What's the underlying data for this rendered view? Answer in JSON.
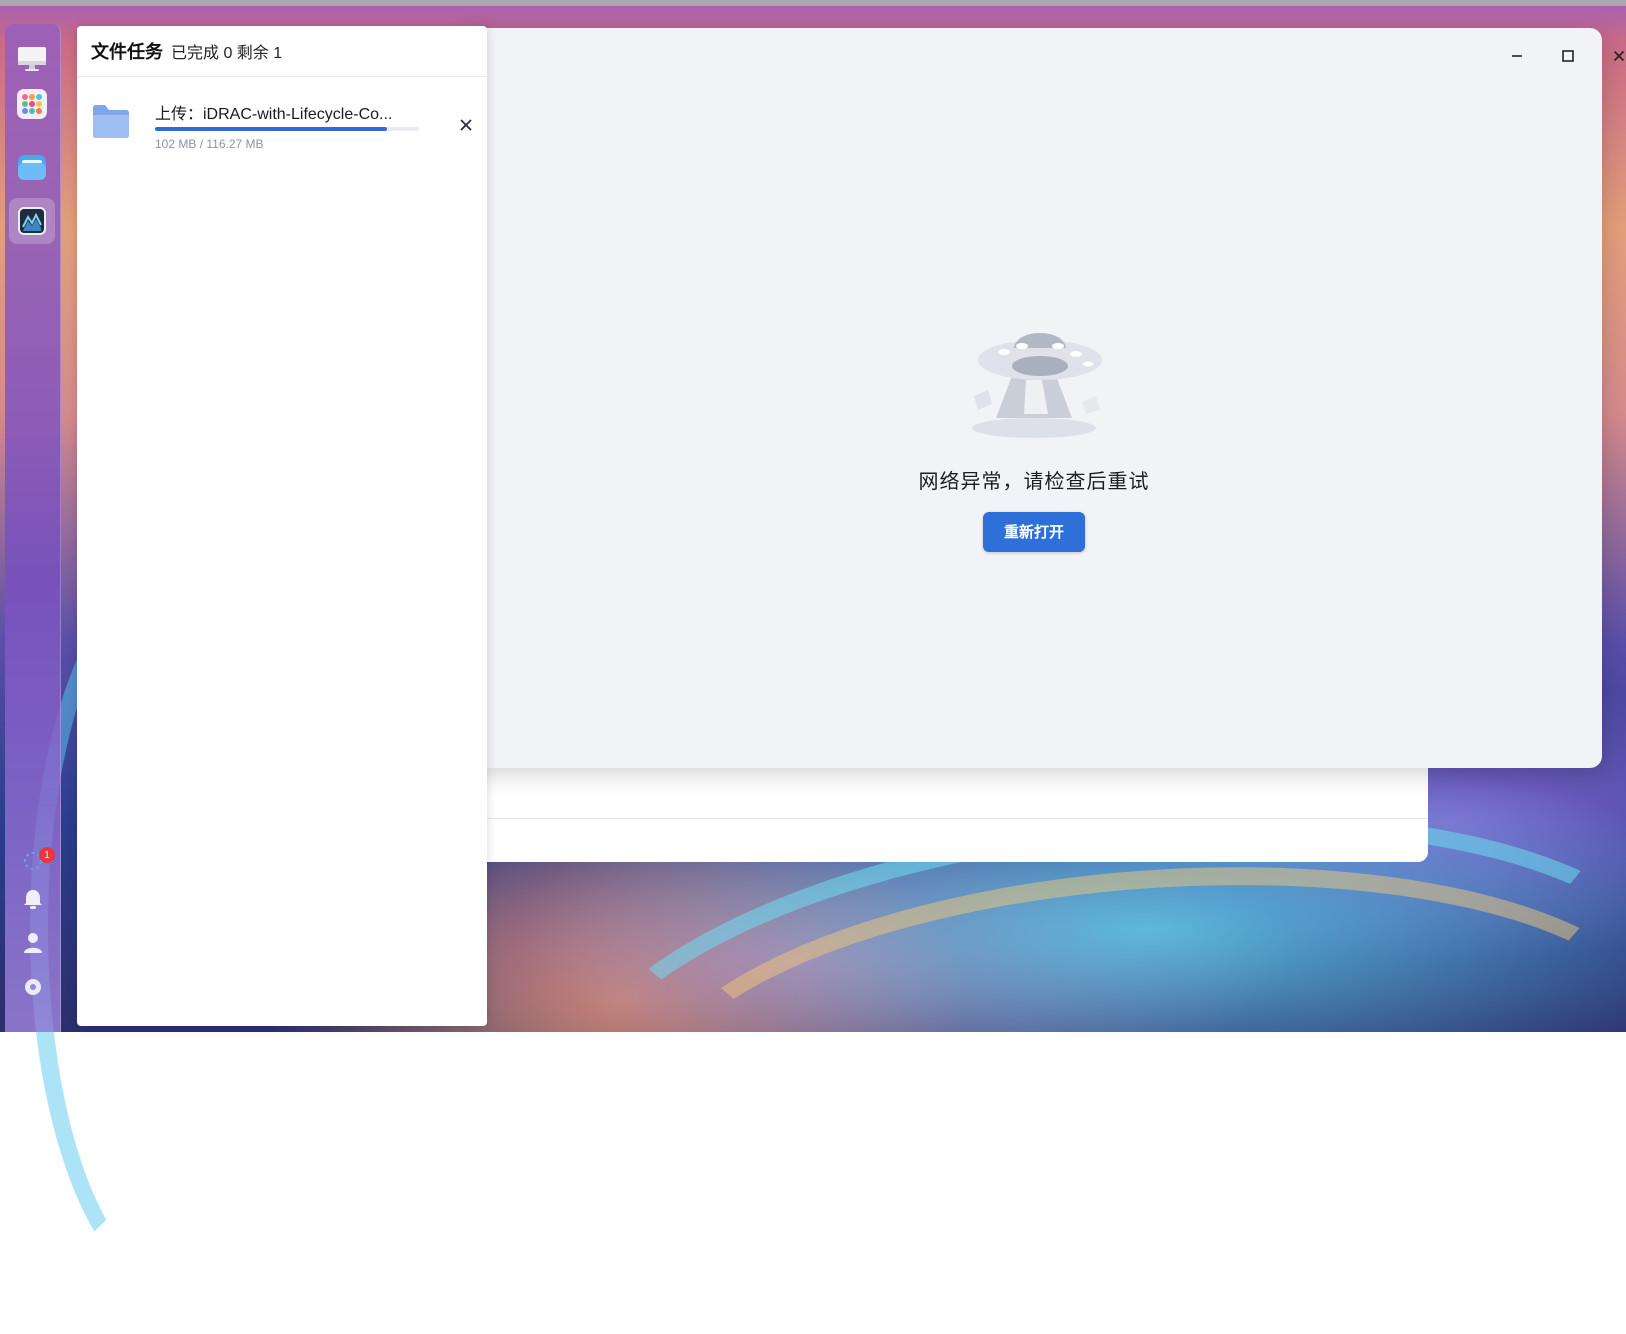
{
  "task_panel": {
    "title": "文件任务",
    "status": "已完成 0 剩余 1",
    "tasks": [
      {
        "name": "上传：iDRAC-with-Lifecycle-Co...",
        "size": "102 MB / 116.27 MB",
        "progress": 0.877,
        "icon": "folder-icon"
      }
    ]
  },
  "window": {
    "controls": [
      "minimize-icon",
      "maximize-icon",
      "close-icon"
    ],
    "error_message": "网络异常，请检查后重试",
    "reopen_label": "重新打开",
    "illustration": "ufo-icon"
  },
  "dock": {
    "items": [
      "desktop-icon",
      "app-launcher-icon",
      "file-manager-icon",
      "resource-monitor-icon"
    ],
    "bottom_items": [
      "task-progress-icon",
      "bell-icon",
      "user-icon",
      "settings-icon"
    ],
    "badge_count": "1"
  },
  "colors": {
    "accent": "#2f6fd8",
    "progress": "#2e6bd6",
    "badge": "#e8383d"
  }
}
